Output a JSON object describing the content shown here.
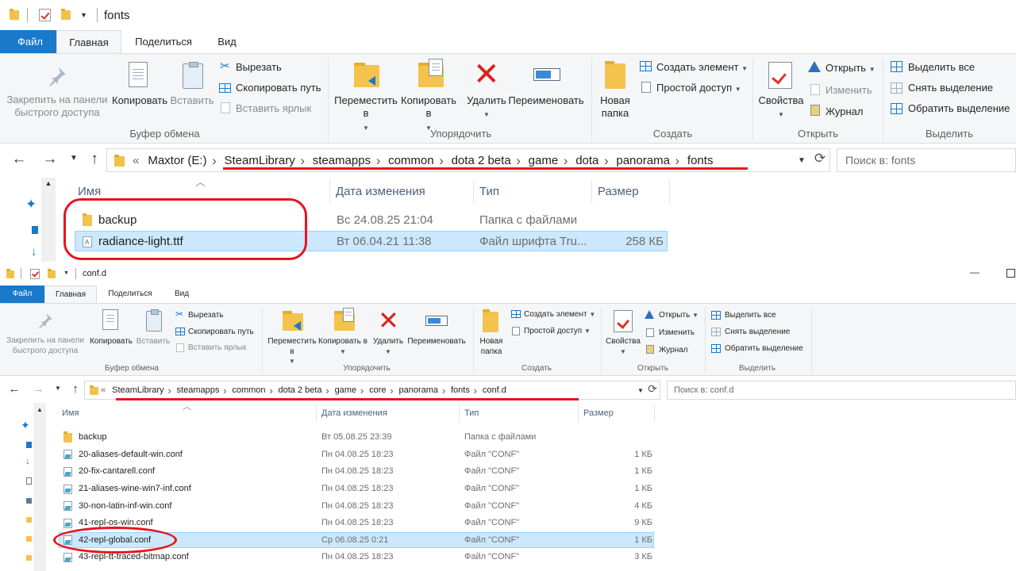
{
  "windows": [
    {
      "title": "fonts",
      "tabs": [
        "Файл",
        "Главная",
        "Поделиться",
        "Вид"
      ],
      "ribbon": {
        "clipboard": {
          "pin": "Закрепить на панели быстрого доступа",
          "copy": "Копировать",
          "paste": "Вставить",
          "cut": "Вырезать",
          "copy_path": "Скопировать путь",
          "paste_shortcut": "Вставить ярлык",
          "group": "Буфер обмена"
        },
        "organize": {
          "move": "Переместить в",
          "copy_to": "Копировать в",
          "delete": "Удалить",
          "rename": "Переименовать",
          "group": "Упорядочить"
        },
        "create": {
          "new_folder": "Новая папка",
          "new_item": "Создать элемент",
          "easy_access": "Простой доступ",
          "group": "Создать"
        },
        "open": {
          "properties": "Свойства",
          "open": "Открыть",
          "edit": "Изменить",
          "history": "Журнал",
          "group": "Открыть"
        },
        "select": {
          "select_all": "Выделить все",
          "select_none": "Снять выделение",
          "invert": "Обратить выделение",
          "group": "Выделить"
        }
      },
      "breadcrumb": [
        "«",
        "Maxtor (E:)",
        "SteamLibrary",
        "steamapps",
        "common",
        "dota 2 beta",
        "game",
        "dota",
        "panorama",
        "fonts"
      ],
      "search_placeholder": "Поиск в: fonts",
      "columns": [
        "Имя",
        "Дата изменения",
        "Тип",
        "Размер"
      ],
      "files": [
        {
          "name": "backup",
          "date": "Вс 24.08.25 21:04",
          "type": "Папка с файлами",
          "size": "",
          "kind": "folder",
          "selected": false
        },
        {
          "name": "radiance-light.ttf",
          "date": "Вт 06.04.21 11:38",
          "type": "Файл шрифта Tru...",
          "size": "258 КБ",
          "kind": "ttf",
          "selected": true
        }
      ]
    },
    {
      "title": "conf.d",
      "tabs": [
        "Файл",
        "Главная",
        "Поделиться",
        "Вид"
      ],
      "ribbon": {
        "clipboard": {
          "pin": "Закрепить на панели быстрого доступа",
          "copy": "Копировать",
          "paste": "Вставить",
          "cut": "Вырезать",
          "copy_path": "Скопировать путь",
          "paste_shortcut": "Вставить ярлык",
          "group": "Буфер обмена"
        },
        "organize": {
          "move": "Переместить в",
          "copy_to": "Копировать в",
          "delete": "Удалить",
          "rename": "Переименовать",
          "group": "Упорядочить"
        },
        "create": {
          "new_folder": "Новая папка",
          "new_item": "Создать элемент",
          "easy_access": "Простой доступ",
          "group": "Создать"
        },
        "open": {
          "properties": "Свойства",
          "open": "Открыть",
          "edit": "Изменить",
          "history": "Журнал",
          "group": "Открыть"
        },
        "select": {
          "select_all": "Выделить все",
          "select_none": "Снять выделение",
          "invert": "Обратить выделение",
          "group": "Выделить"
        }
      },
      "breadcrumb": [
        "«",
        "SteamLibrary",
        "steamapps",
        "common",
        "dota 2 beta",
        "game",
        "core",
        "panorama",
        "fonts",
        "conf.d"
      ],
      "search_placeholder": "Поиск в: conf.d",
      "columns": [
        "Имя",
        "Дата изменения",
        "Тип",
        "Размер"
      ],
      "files": [
        {
          "name": "backup",
          "date": "Вт 05.08.25 23:39",
          "type": "Папка с файлами",
          "size": "",
          "kind": "folder",
          "selected": false
        },
        {
          "name": "20-aliases-default-win.conf",
          "date": "Пн 04.08.25 18:23",
          "type": "Файл \"CONF\"",
          "size": "1 КБ",
          "kind": "conf",
          "selected": false
        },
        {
          "name": "20-fix-cantarell.conf",
          "date": "Пн 04.08.25 18:23",
          "type": "Файл \"CONF\"",
          "size": "1 КБ",
          "kind": "conf",
          "selected": false
        },
        {
          "name": "21-aliases-wine-win7-inf.conf",
          "date": "Пн 04.08.25 18:23",
          "type": "Файл \"CONF\"",
          "size": "1 КБ",
          "kind": "conf",
          "selected": false
        },
        {
          "name": "30-non-latin-inf-win.conf",
          "date": "Пн 04.08.25 18:23",
          "type": "Файл \"CONF\"",
          "size": "4 КБ",
          "kind": "conf",
          "selected": false
        },
        {
          "name": "41-repl-os-win.conf",
          "date": "Пн 04.08.25 18:23",
          "type": "Файл \"CONF\"",
          "size": "9 КБ",
          "kind": "conf",
          "selected": false
        },
        {
          "name": "42-repl-global.conf",
          "date": "Ср 06.08.25 0:21",
          "type": "Файл \"CONF\"",
          "size": "1 КБ",
          "kind": "conf",
          "selected": true
        },
        {
          "name": "43-repl-tt-traced-bitmap.conf",
          "date": "Пн 04.08.25 18:23",
          "type": "Файл \"CONF\"",
          "size": "3 КБ",
          "kind": "conf",
          "selected": false
        }
      ]
    }
  ],
  "colors": {
    "file_tab": "#1979ca",
    "selection": "#cce8ff",
    "annotation_red": "#e8141a"
  }
}
